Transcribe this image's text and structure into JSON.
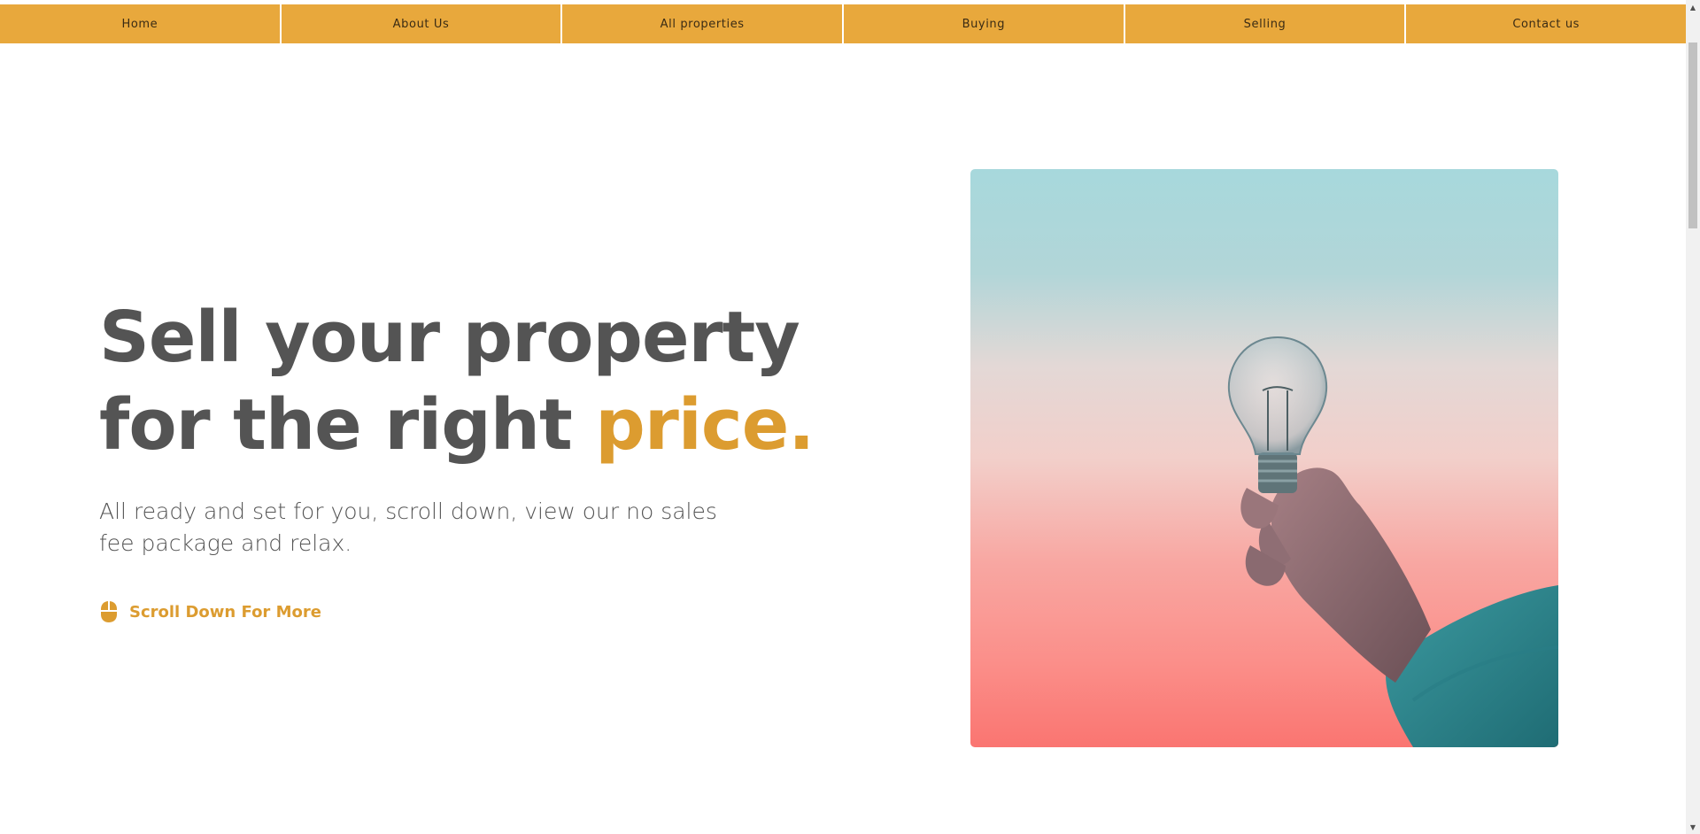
{
  "nav": {
    "items": [
      {
        "label": "Home"
      },
      {
        "label": "About Us"
      },
      {
        "label": "All properties"
      },
      {
        "label": "Buying"
      },
      {
        "label": "Selling"
      },
      {
        "label": "Contact us"
      }
    ]
  },
  "hero": {
    "title_line1": "Sell your property",
    "title_line2_start": "for the right ",
    "title_line2_accent": "price.",
    "subtitle": "All ready and set for you, scroll down, view our no sales fee package and relax.",
    "scroll_cta": "Scroll Down For More",
    "scroll_icon": "mouse-icon",
    "image": "hand-holding-lightbulb-photo"
  },
  "colors": {
    "nav_bg": "#e8a83c",
    "accent": "#dc9c30",
    "text": "#545454"
  }
}
